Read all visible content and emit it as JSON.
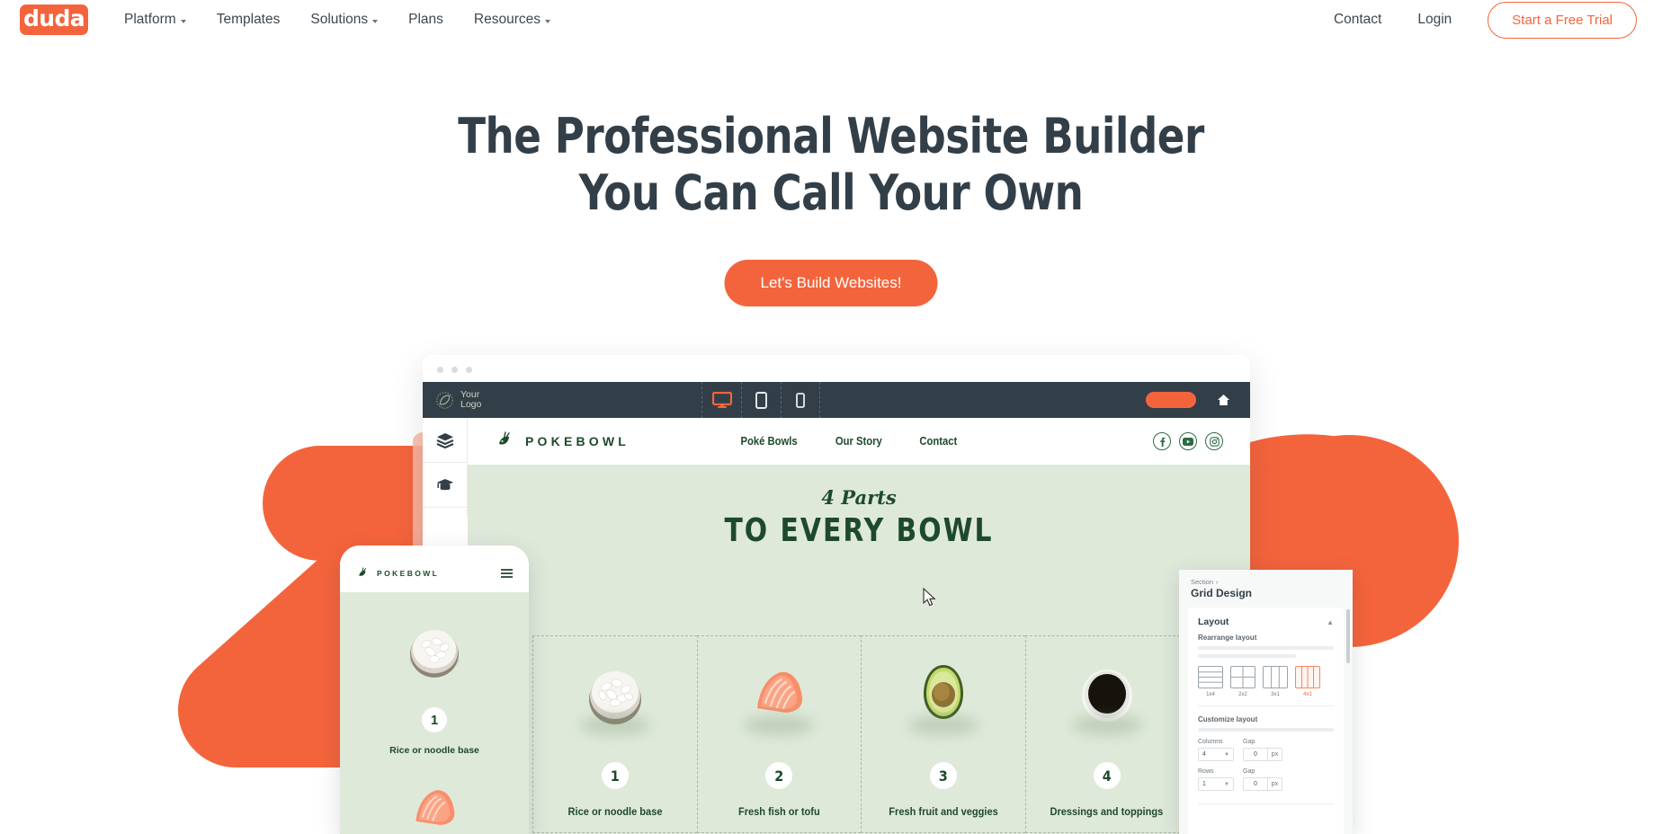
{
  "brand": {
    "logo_text": "duda",
    "accent": "#f4643c",
    "dark": "#333f48"
  },
  "topnav": {
    "items": [
      {
        "label": "Platform",
        "has_caret": true
      },
      {
        "label": "Templates",
        "has_caret": false
      },
      {
        "label": "Solutions",
        "has_caret": true
      },
      {
        "label": "Plans",
        "has_caret": false
      },
      {
        "label": "Resources",
        "has_caret": true
      }
    ],
    "right": [
      {
        "label": "Contact"
      },
      {
        "label": "Login"
      }
    ],
    "cta": "Start a Free Trial"
  },
  "hero": {
    "title_line1": "The Professional Website Builder",
    "title_line2": "You Can Call Your Own",
    "cta": "Let's Build Websites!"
  },
  "editor": {
    "logo_line1": "Your",
    "logo_line2": "Logo",
    "devices": [
      {
        "name": "desktop",
        "active": true
      },
      {
        "name": "tablet",
        "active": false
      },
      {
        "name": "mobile",
        "active": false
      }
    ],
    "rail": [
      {
        "icon": "layers-icon"
      },
      {
        "icon": "graduation-cap-icon"
      }
    ]
  },
  "site": {
    "logo_text": "POKEBOWL",
    "nav": [
      "Poké Bowls",
      "Our Story",
      "Contact"
    ],
    "socials": [
      "facebook-icon",
      "youtube-icon",
      "instagram-icon"
    ],
    "eyebrow": "4 Parts",
    "title": "TO EVERY BOWL",
    "cells": [
      {
        "num": "1",
        "label": "Rice or noodle base",
        "food": "rice-bowl"
      },
      {
        "num": "2",
        "label": "Fresh fish or tofu",
        "food": "salmon"
      },
      {
        "num": "3",
        "label": "Fresh fruit and veggies",
        "food": "avocado"
      },
      {
        "num": "4",
        "label": "Dressings and toppings",
        "food": "sauce-bowl"
      }
    ]
  },
  "phone": {
    "logo_text": "POKEBOWL",
    "num": "1",
    "label": "Rice or noodle base"
  },
  "panel": {
    "breadcrumb": "Section",
    "breadcrumb_sep": "›",
    "title": "Grid Design",
    "section_title": "Layout",
    "rearrange_label": "Rearrange layout",
    "layouts": [
      {
        "label": "1x4",
        "selected": false,
        "kind": "rows4"
      },
      {
        "label": "2x2",
        "selected": false,
        "kind": "quad"
      },
      {
        "label": "3x1",
        "selected": false,
        "kind": "cols3"
      },
      {
        "label": "4x1",
        "selected": true,
        "kind": "cols4"
      }
    ],
    "customize_label": "Customize layout",
    "fields": [
      {
        "label": "Columns",
        "value": "4",
        "gap_label": "Gap",
        "gap_value": "0",
        "gap_unit": "px"
      },
      {
        "label": "Rows",
        "value": "1",
        "gap_label": "Gap",
        "gap_value": "0",
        "gap_unit": "px"
      }
    ]
  }
}
